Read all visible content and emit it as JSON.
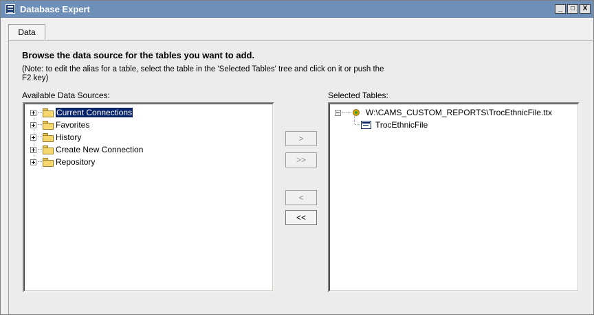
{
  "window": {
    "title": "Database Expert",
    "controls": [
      "_",
      "□",
      "X"
    ]
  },
  "tabs": [
    {
      "label": "Data"
    }
  ],
  "content": {
    "heading": "Browse the data source for the tables you want to add.",
    "note": "(Note: to edit the alias for a table, select the table in the 'Selected Tables' tree and click on it or push the F2 key)",
    "available_label": "Available Data Sources:",
    "selected_label": "Selected Tables:"
  },
  "available_sources": [
    {
      "label": "Current Connections",
      "selected": true
    },
    {
      "label": "Favorites",
      "selected": false
    },
    {
      "label": "History",
      "selected": false
    },
    {
      "label": "Create New Connection",
      "selected": false
    },
    {
      "label": "Repository",
      "selected": false
    }
  ],
  "selected_tables": [
    {
      "label": "W:\\CAMS_CUSTOM_REPORTS\\TrocEthnicFile.ttx",
      "type": "connection",
      "expanded": true
    },
    {
      "label": "TrocEthnicFile",
      "type": "table"
    }
  ],
  "buttons": {
    "add": ">",
    "add_all": ">>",
    "remove": "<",
    "remove_all": "<<"
  },
  "colors": {
    "titlebar": "#6d8fb8",
    "selection": "#0a246a"
  }
}
